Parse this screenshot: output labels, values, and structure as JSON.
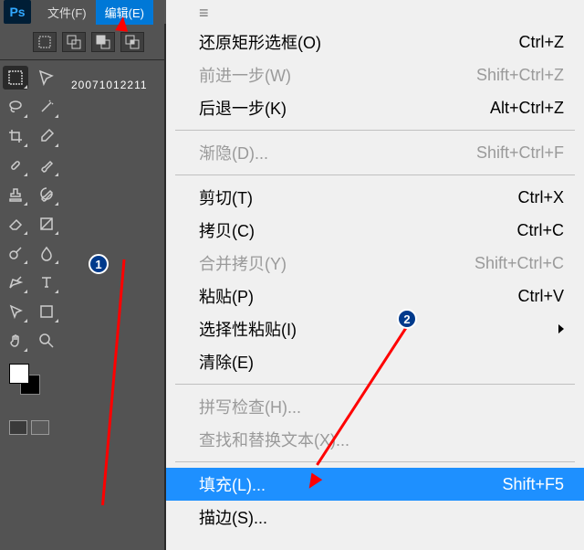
{
  "menubar": {
    "file": "文件(F)",
    "edit": "编辑(E)"
  },
  "doc_tab": "20071012211",
  "dropdown": {
    "undo": {
      "label": "还原矩形选框(O)",
      "shortcut": "Ctrl+Z"
    },
    "step_forward": {
      "label": "前进一步(W)",
      "shortcut": "Shift+Ctrl+Z"
    },
    "step_backward": {
      "label": "后退一步(K)",
      "shortcut": "Alt+Ctrl+Z"
    },
    "fade": {
      "label": "渐隐(D)...",
      "shortcut": "Shift+Ctrl+F"
    },
    "cut": {
      "label": "剪切(T)",
      "shortcut": "Ctrl+X"
    },
    "copy": {
      "label": "拷贝(C)",
      "shortcut": "Ctrl+C"
    },
    "merge_copy": {
      "label": "合并拷贝(Y)",
      "shortcut": "Shift+Ctrl+C"
    },
    "paste": {
      "label": "粘贴(P)",
      "shortcut": "Ctrl+V"
    },
    "paste_special": {
      "label": "选择性粘贴(I)"
    },
    "clear": {
      "label": "清除(E)"
    },
    "spell": {
      "label": "拼写检查(H)..."
    },
    "find_replace": {
      "label": "查找和替换文本(X)..."
    },
    "fill": {
      "label": "填充(L)...",
      "shortcut": "Shift+F5"
    },
    "stroke": {
      "label": "描边(S)..."
    }
  },
  "badges": {
    "b1": "1",
    "b2": "2"
  }
}
